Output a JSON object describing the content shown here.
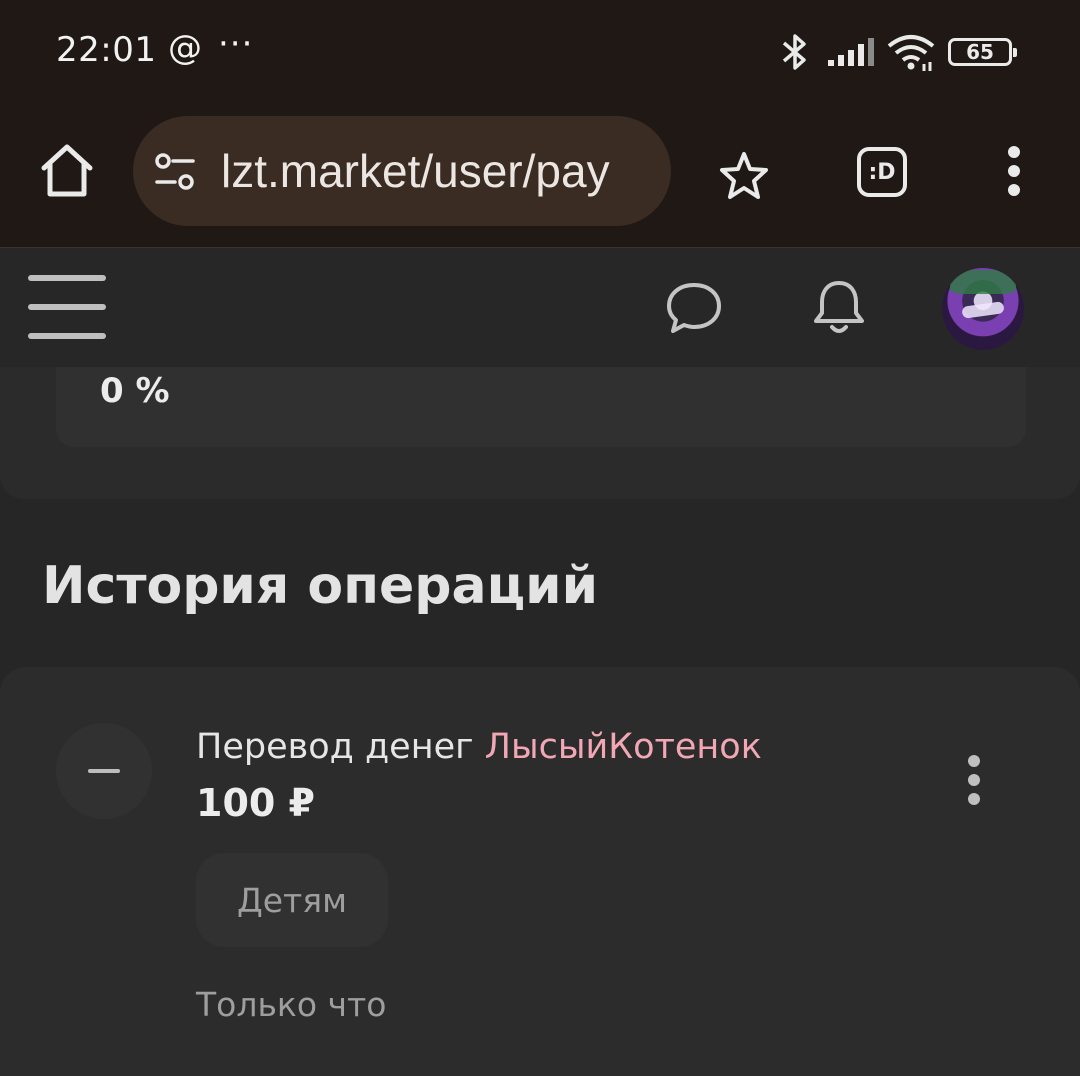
{
  "status_bar": {
    "time": "22:01",
    "at_symbol": "@",
    "more_indicator": "···",
    "battery_level": "65",
    "icons": [
      "bluetooth-icon",
      "signal-icon",
      "wifi-icon",
      "battery-icon"
    ]
  },
  "browser": {
    "url": "lzt.market/user/pay",
    "tab_switcher_label": ":D",
    "icons": [
      "home-icon",
      "site-settings-icon",
      "star-icon",
      "tab-switcher-icon",
      "overflow-menu-icon"
    ]
  },
  "site_header": {
    "icons": [
      "hamburger-menu-icon",
      "chat-icon",
      "bell-icon",
      "avatar"
    ]
  },
  "summary_card": {
    "percent": "0 %"
  },
  "history": {
    "title": "История операций",
    "operations": [
      {
        "title_prefix": "Перевод денег",
        "user": "ЛысыйКотенок",
        "amount": "100 ₽",
        "tag": "Детям",
        "time": "Только что"
      }
    ]
  },
  "colors": {
    "page_bg": "#262626",
    "chrome_bg": "#1f1814",
    "url_pill_bg": "#3a2c23",
    "username_accent": "#f2a7b4"
  }
}
